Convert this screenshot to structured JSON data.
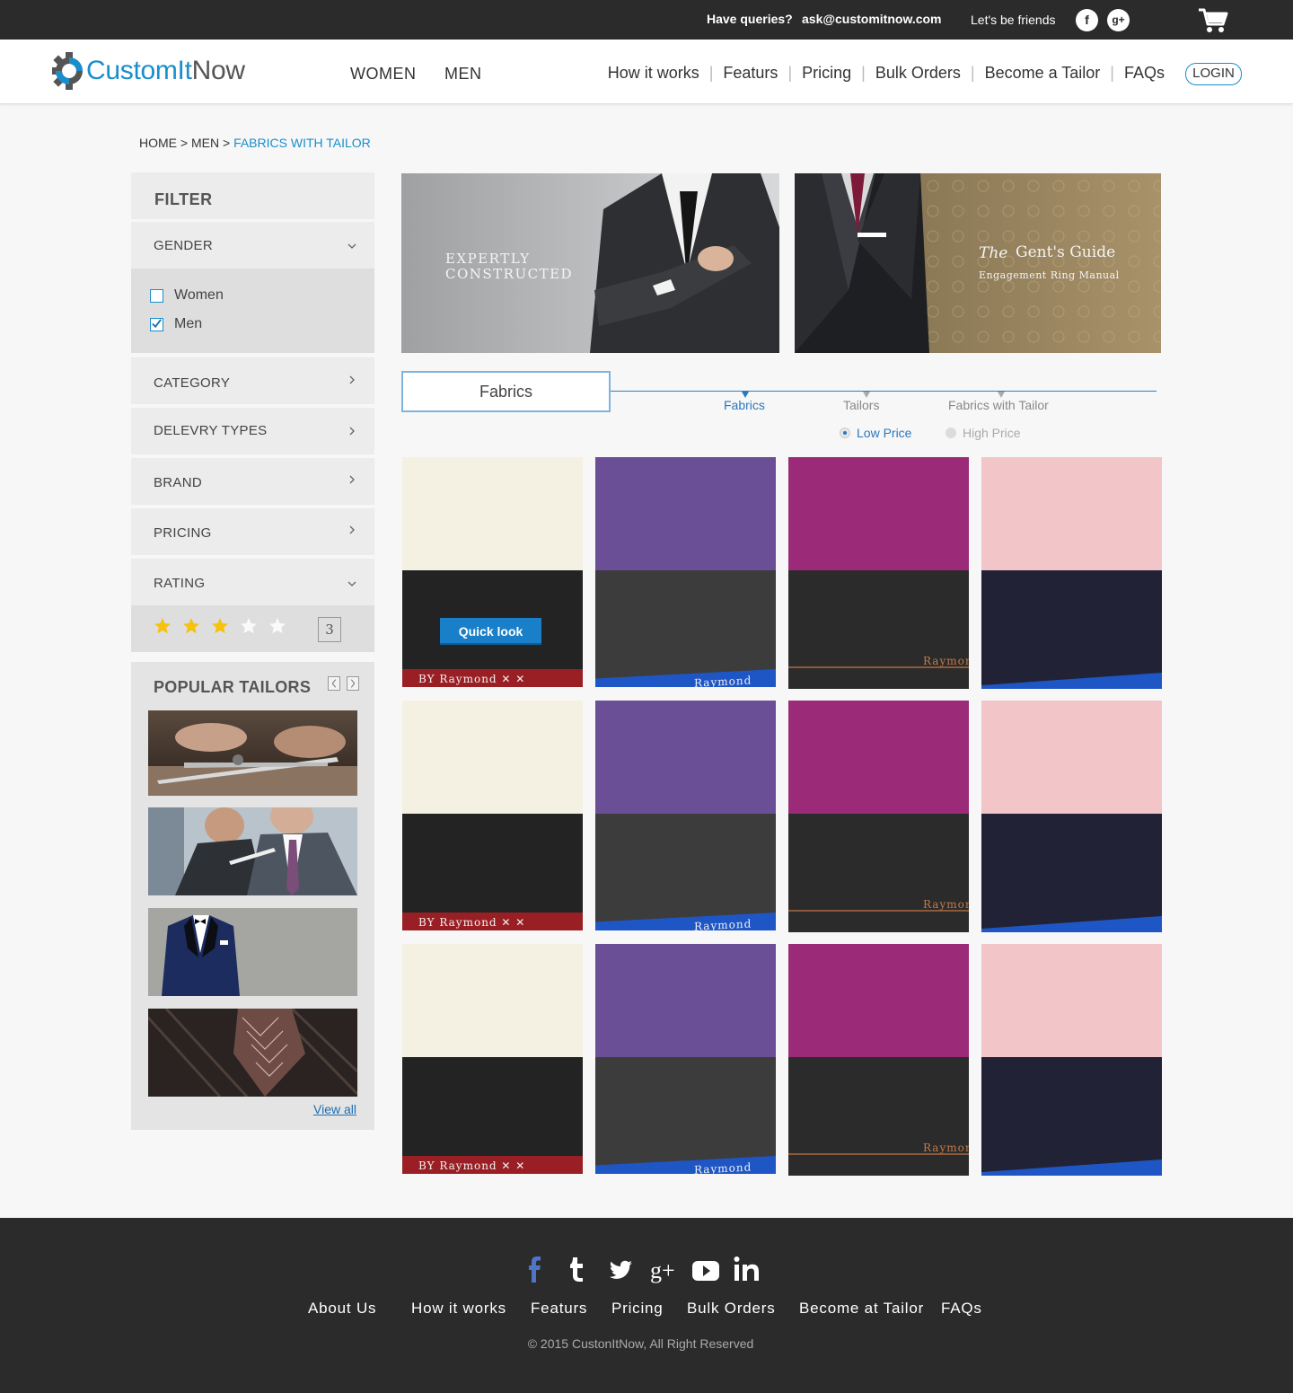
{
  "topbar": {
    "queries_label": "Have queries?",
    "email": "ask@customitnow.com",
    "friends_label": "Let's be friends",
    "facebook_glyph": "f",
    "googleplus_glyph": "g+"
  },
  "header": {
    "logo_part1": "CustomIt",
    "logo_part2": "Now",
    "main_nav": [
      "WOMEN",
      "MEN"
    ],
    "right_nav": [
      "How it works",
      "Featurs",
      "Pricing",
      "Bulk Orders",
      "Become a Tailor",
      "FAQs"
    ],
    "login_label": "LOGIN"
  },
  "breadcrumb": {
    "home": "HOME",
    "sep": " > ",
    "men": "MEN",
    "current": "FABRICS WITH TAILOR"
  },
  "filter": {
    "title": "FILTER",
    "gender": {
      "label": "GENDER",
      "options": [
        {
          "label": "Women",
          "checked": false
        },
        {
          "label": "Men",
          "checked": true
        }
      ]
    },
    "sections": [
      "CATEGORY",
      "DELEVRY TYPES",
      "BRAND",
      "PRICING"
    ],
    "rating": {
      "label": "RATING",
      "value": 3,
      "max": 5,
      "box_value": "3"
    }
  },
  "popular_tailors": {
    "title": "POPULAR TAILORS",
    "view_all": "View all"
  },
  "banners": {
    "left_line1": "EXPERTLY",
    "left_line2": "CONSTRUCTED",
    "right_title_italic": "The",
    "right_title": "Gent's Guide",
    "right_subtitle": "Engagement Ring Manual"
  },
  "tabs": {
    "active_tab": "Fabrics",
    "steps": [
      "Fabrics",
      "Tailors",
      "Fabrics with Tailor"
    ],
    "active_step": "Fabrics",
    "sort_options": [
      "Low Price",
      "High Price"
    ],
    "selected_sort": "Low Price"
  },
  "products": {
    "quick_look": "Quick look",
    "selvedge_labels": [
      "BY   Raymond   ✕ ✕",
      "Raymond",
      "Raymond"
    ],
    "colors": {
      "cream_top": "#f4f1e2",
      "purple_top": "#6a4f96",
      "magenta_top": "#9b2a78",
      "pink_top": "#f2c6c8",
      "black_bottom": "#232323",
      "grey_bottom": "#3c3c3c",
      "charcoal_bottom": "#2b2b2b",
      "navy_bottom": "#212236",
      "red_selvedge": "#9a1f24",
      "blue_selvedge": "#1f56c6"
    }
  },
  "footer": {
    "links": [
      "About Us",
      "How it works",
      "Featurs",
      "Pricing",
      "Bulk Orders",
      "Become at Tailor",
      "FAQs"
    ],
    "copyright": "© 2015 CustonItNow, All Right Reserved"
  },
  "colors": {
    "brand_blue": "#1a8ecb",
    "dark_bar": "#2b2b2b",
    "star_gold": "#f5c20e"
  }
}
